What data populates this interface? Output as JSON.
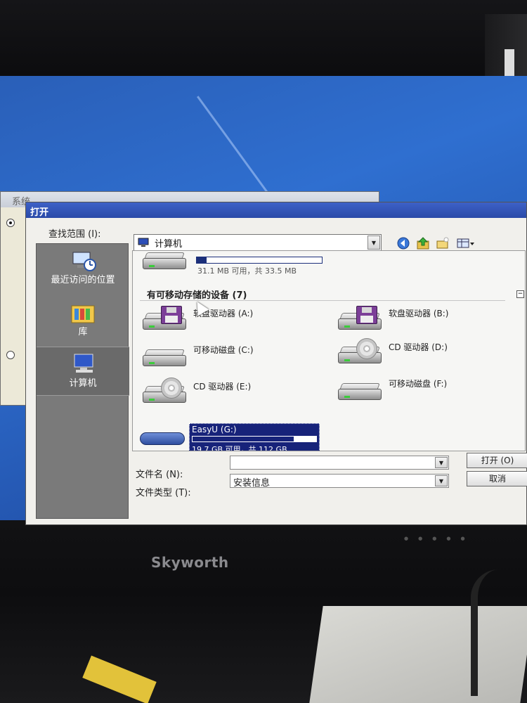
{
  "monitor": {
    "brand": "Skyworth"
  },
  "background_window": {
    "title": "系统..."
  },
  "dialog": {
    "title": "打开",
    "look_in": {
      "label": "查找范围 (I):",
      "value": "计算机"
    },
    "toolbar": {
      "back_icon": "back-arrow-icon",
      "up_icon": "up-folder-icon",
      "new_folder_icon": "new-folder-icon",
      "view_icon": "view-menu-icon"
    },
    "places": [
      {
        "label": "最近访问的位置",
        "icon": "recent-places-icon",
        "selected": false
      },
      {
        "label": "库",
        "icon": "library-icon",
        "selected": false
      },
      {
        "label": "计算机",
        "icon": "computer-icon",
        "selected": true
      }
    ],
    "file_list": {
      "top_drive_free": "31.1 MB 可用，共 33.5 MB",
      "top_drive_usage": 0.08,
      "group_header": "有可移动存储的设备 (7)",
      "collapse_symbol": "−",
      "devices": [
        {
          "name": "软盘驱动器 (A:)",
          "icon": "floppy-drive-icon"
        },
        {
          "name": "软盘驱动器 (B:)",
          "icon": "floppy-drive-icon"
        },
        {
          "name": "可移动磁盘 (C:)",
          "icon": "removable-disk-icon"
        },
        {
          "name": "CD 驱动器 (D:)",
          "icon": "cd-drive-icon"
        },
        {
          "name": "CD 驱动器 (E:)",
          "icon": "cd-drive-icon"
        },
        {
          "name": "可移动磁盘 (F:)",
          "icon": "removable-disk-icon"
        }
      ],
      "selected_device": {
        "name": "EasyU (G:)",
        "free": "19.7 GB 可用，共 112 GB",
        "usage": 0.82,
        "icon": "usb-drive-icon"
      }
    },
    "file_name": {
      "label": "文件名 (N):",
      "value": ""
    },
    "file_type": {
      "label": "文件类型 (T):",
      "value": "安装信息"
    },
    "buttons": {
      "open": "打开 (O)",
      "cancel": "取消"
    }
  }
}
